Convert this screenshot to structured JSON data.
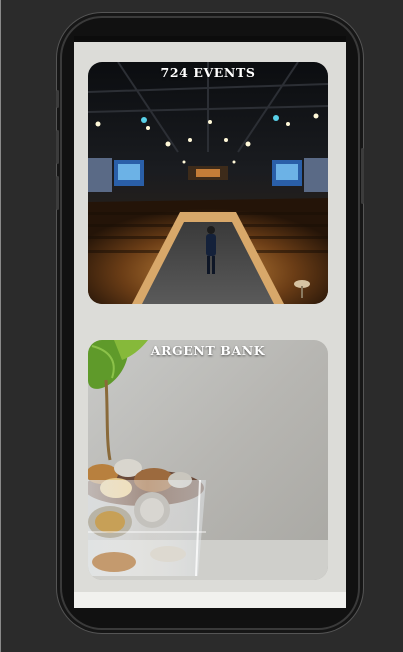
{
  "cards": [
    {
      "title": "724 EVENTS",
      "image": "conference-hall-photo"
    },
    {
      "title": "ARGENT BANK",
      "image": "coin-jar-plant-photo"
    }
  ],
  "colors": {
    "background": "#2b2b2b",
    "screen": "#dcdcd8",
    "phone_frame": "#111111"
  }
}
